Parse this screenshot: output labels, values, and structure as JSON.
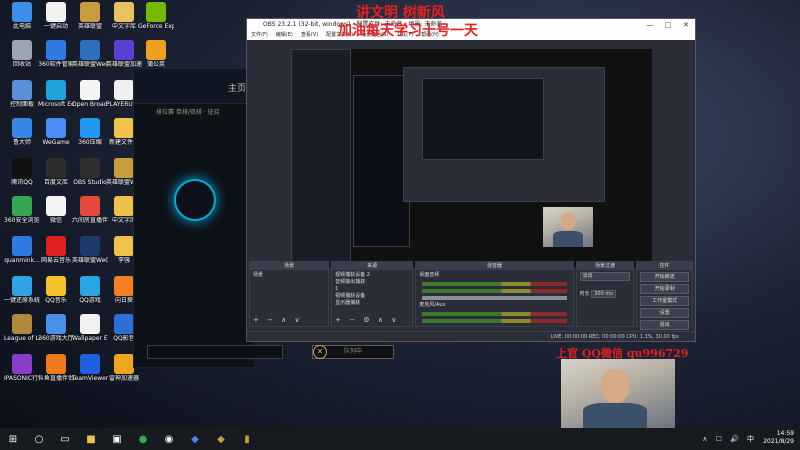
{
  "desktop": {
    "icons": [
      {
        "label": "此电脑",
        "color": "#3d8ee8"
      },
      {
        "label": "一键启动",
        "color": "#f2f2f2"
      },
      {
        "label": "英雄联盟",
        "color": "#c89b3c"
      },
      {
        "label": "中文字库",
        "color": "#e8c35d"
      },
      {
        "label": "GeForce Experience",
        "color": "#76b900"
      },
      {
        "label": "回收站",
        "color": "#9aa6b2"
      },
      {
        "label": "360软件管家",
        "color": "#2e7be4"
      },
      {
        "label": "英雄联盟WeGame版",
        "color": "#2d6fbf"
      },
      {
        "label": "英雄联盟加速器",
        "color": "#5b3fd4"
      },
      {
        "label": "蒲公英",
        "color": "#f0a020"
      },
      {
        "label": "控制面板",
        "color": "#5b8fd9"
      },
      {
        "label": "Microsoft Edge",
        "color": "#1fa3d8"
      },
      {
        "label": "Open Broadcaster",
        "color": "#f5f5f5"
      },
      {
        "label": "PLAYERU BATTLEGR",
        "color": "#f0f0f0"
      },
      {
        "label": "鲁大师",
        "color": "#3a86e6"
      },
      {
        "label": "WeGame",
        "color": "#4c8cf5"
      },
      {
        "label": "360压缩",
        "color": "#2196f3"
      },
      {
        "label": "新建文件夹",
        "color": "#f0c24a"
      },
      {
        "label": "腾讯QQ",
        "color": "#111111"
      },
      {
        "label": "百度文库",
        "color": "#2d2d2d"
      },
      {
        "label": "OBS Studio",
        "color": "#302e31"
      },
      {
        "label": "英雄联盟WeGame版",
        "color": "#c89b3c"
      },
      {
        "label": "360安全浏览器",
        "color": "#34a853"
      },
      {
        "label": "微信",
        "color": "#f5f5f5"
      },
      {
        "label": "六间房直播伴侣",
        "color": "#e64a3c"
      },
      {
        "label": "中文字库",
        "color": "#efc04a"
      },
      {
        "label": "quanmink...",
        "color": "#2e7be4"
      },
      {
        "label": "网易云音乐",
        "color": "#e02020"
      },
      {
        "label": "英雄联盟WeGame版",
        "color": "#1d3a6a"
      },
      {
        "label": "李强",
        "color": "#f0c24a"
      },
      {
        "label": "一键还原系统",
        "color": "#2ea4e6"
      },
      {
        "label": "QQ音乐",
        "color": "#f5c22a"
      },
      {
        "label": "QQ游戏",
        "color": "#2aa5e6"
      },
      {
        "label": "向日葵",
        "color": "#f37f21"
      },
      {
        "label": "League of Legends",
        "color": "#b08a3a"
      },
      {
        "label": "360游戏大厅",
        "color": "#4a8fe8"
      },
      {
        "label": "Wallpaper Engine",
        "color": "#f2f2f2"
      },
      {
        "label": "QQ影音",
        "color": "#2d6fd8"
      },
      {
        "label": "IPASONIC行情软件",
        "color": "#8a3cc8"
      },
      {
        "label": "斗鱼直播伴侣",
        "color": "#f07a1a"
      },
      {
        "label": "TeamViewer",
        "color": "#1f5fe0"
      },
      {
        "label": "雷神加速器",
        "color": "#f0a51d"
      }
    ]
  },
  "lol_client": {
    "home_label": "主页",
    "tabs": "排位赛 单排/双排 · 征召",
    "queue_button": "队列中",
    "accent": "#0aa7d9"
  },
  "obs": {
    "title": "OBS 23.2.1 (32-bit, windows) - 配置文件: 未命名 - 场景: 未命名",
    "window_controls": [
      "—",
      "□",
      "✕"
    ],
    "menu": [
      "文件(F)",
      "编辑(E)",
      "查看(V)",
      "配置文件(P)",
      "场景集合(S)",
      "工具(T)",
      "帮助(H)"
    ],
    "docks": {
      "scenes": {
        "title": "场景",
        "items": [
          "场景"
        ]
      },
      "sources": {
        "title": "来源",
        "items": [
          "视频捕获设备 2",
          "音频输出捕获",
          "",
          "1",
          "视频捕获设备",
          "显示器捕获"
        ]
      },
      "mixer": {
        "title": "混音器",
        "channels": [
          "桌面音频",
          "麦克风/Aux"
        ]
      },
      "transitions": {
        "title": "场景过渡",
        "type": "淡出",
        "duration_label": "时长",
        "duration": "300 ms"
      },
      "controls": {
        "title": "控件",
        "buttons": [
          "开始推流",
          "开始录制",
          "工作室模式",
          "设置",
          "退出"
        ]
      }
    },
    "status": "LIVE: 00:00:00   REC: 00:00:00   CPU: 1.3%, 30.00 fps"
  },
  "overlays": {
    "top_line1": "讲文明 树新风",
    "top_line2": "加油每天学习十号一天",
    "bottom_line": "上官 QQ微信 qu996729",
    "color": "#e42020"
  },
  "taskbar": {
    "time": "14:59",
    "date": "2021/8/29",
    "lang": "中",
    "tray": "∧ ☐ 🔊"
  }
}
